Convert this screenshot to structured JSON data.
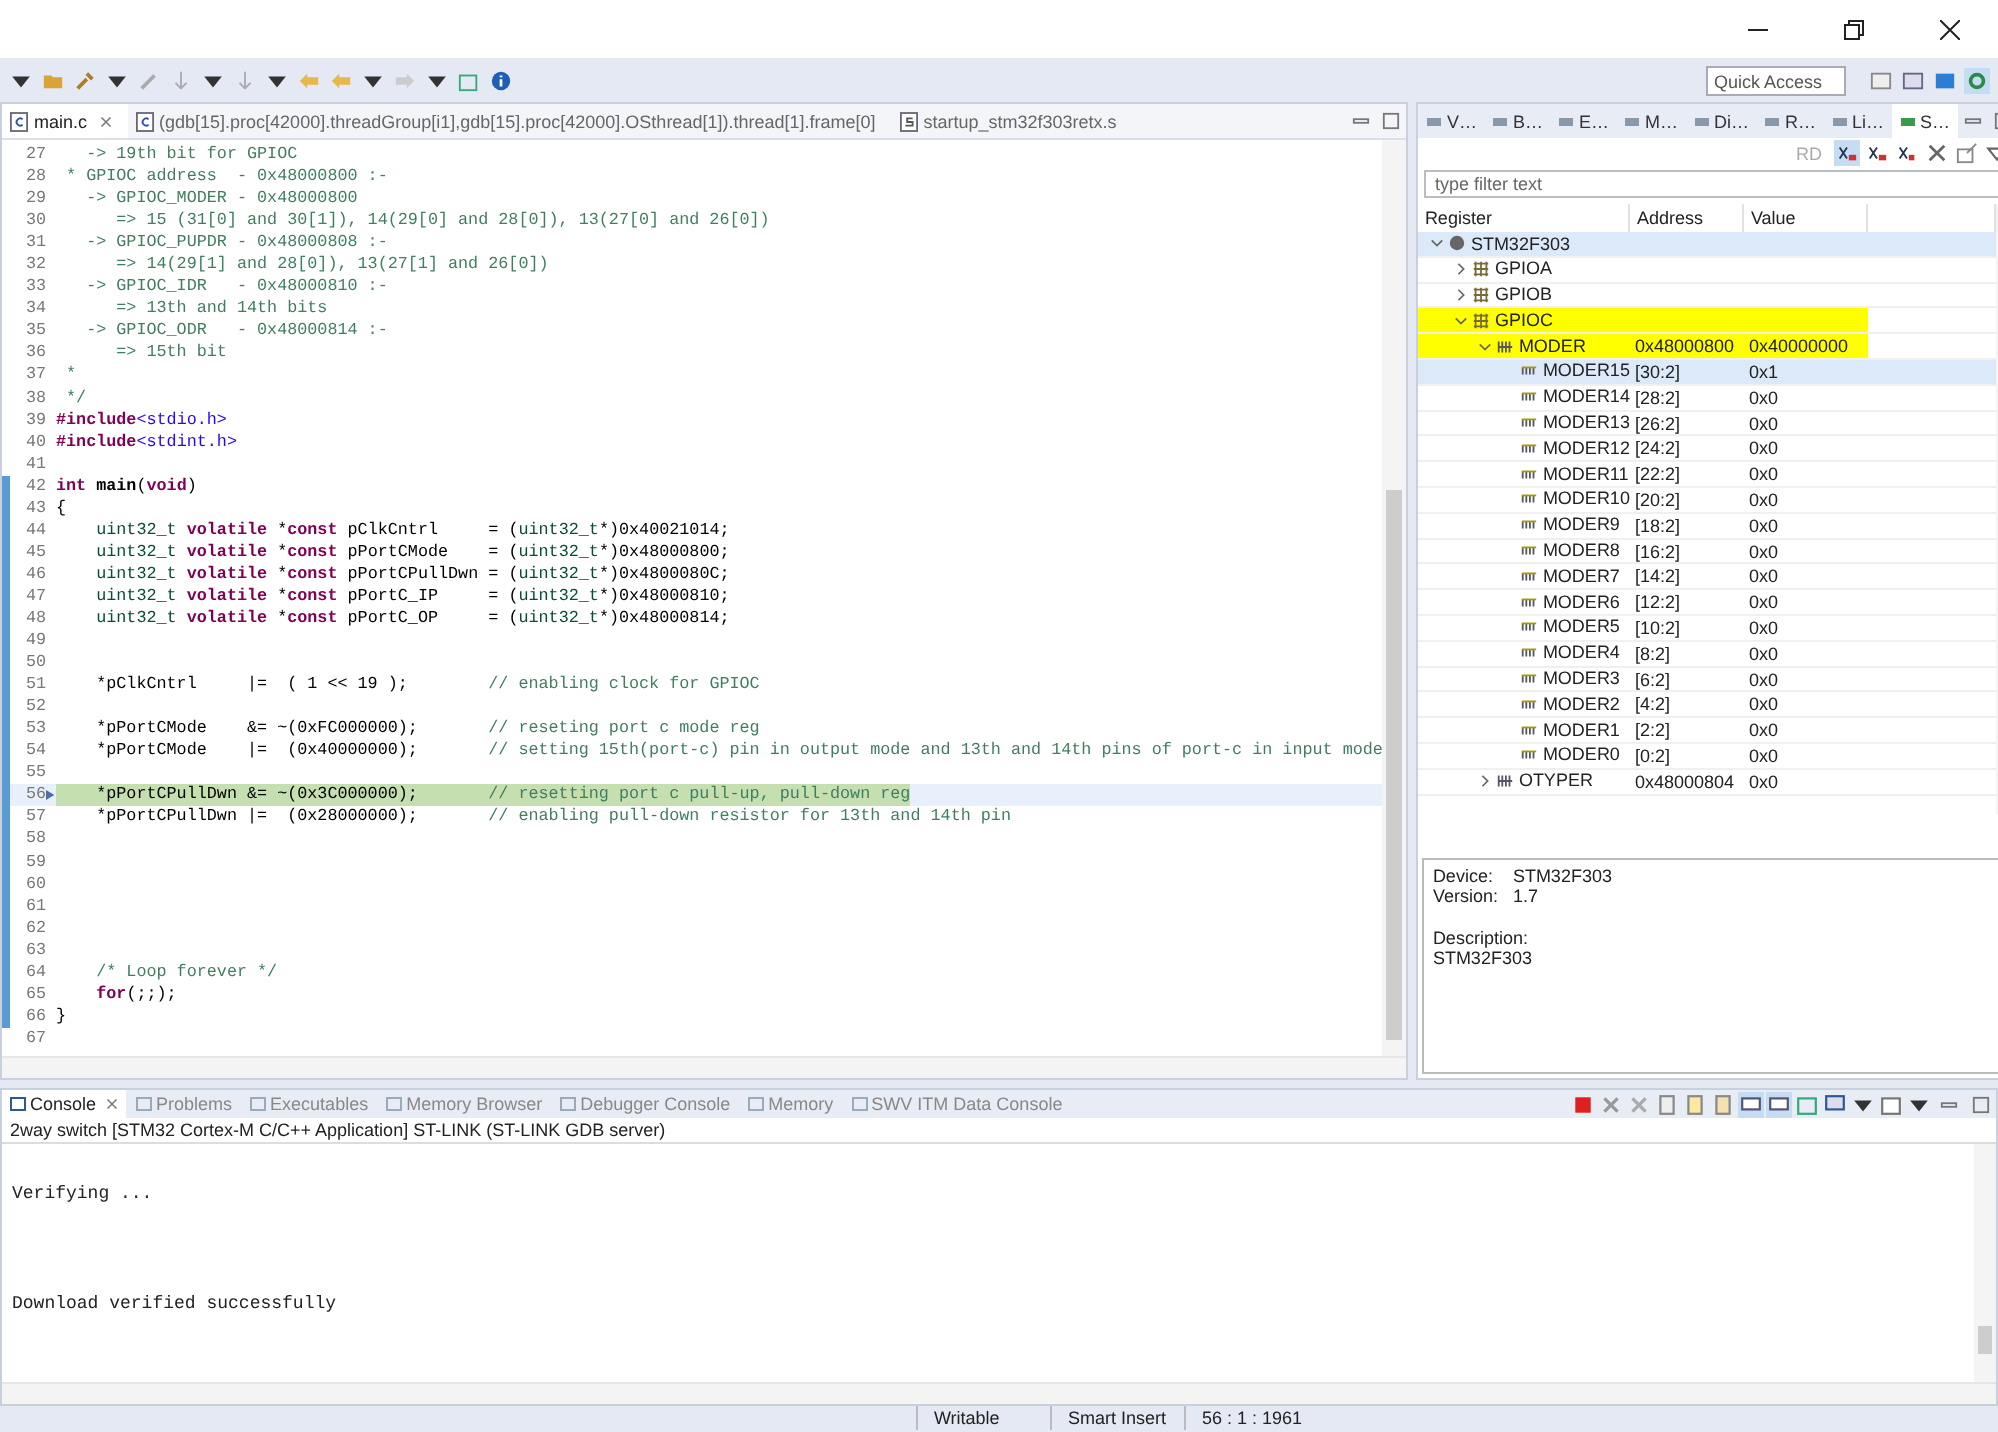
{
  "toolbar": {
    "quick_access": {
      "placeholder": "Quick Access"
    }
  },
  "editor": {
    "tabs": [
      {
        "label": "main.c",
        "kind": "c",
        "selected": true
      },
      {
        "label": "(gdb[15].proc[42000].threadGroup[i1],gdb[15].proc[42000].OSthread[1]).thread[1].frame[0]",
        "kind": "c",
        "selected": false
      },
      {
        "label": "startup_stm32f303retx.s",
        "kind": "s",
        "selected": false
      }
    ],
    "lines": [
      {
        "number": "27",
        "current": false,
        "scope": false,
        "segments": [
          {
            "kind": "comment",
            "text": "   -> 19th bit for GPIOC"
          }
        ]
      },
      {
        "number": "28",
        "current": false,
        "scope": false,
        "segments": [
          {
            "kind": "comment",
            "text": " * GPIOC address  - 0x48000800 :-"
          }
        ]
      },
      {
        "number": "29",
        "current": false,
        "scope": false,
        "segments": [
          {
            "kind": "comment",
            "text": "   -> GPIOC_MODER - 0x48000800"
          }
        ]
      },
      {
        "number": "30",
        "current": false,
        "scope": false,
        "segments": [
          {
            "kind": "comment",
            "text": "      => 15 (31[0] and 30[1]), 14(29[0] and 28[0]), 13(27[0] and 26[0])"
          }
        ]
      },
      {
        "number": "31",
        "current": false,
        "scope": false,
        "segments": [
          {
            "kind": "comment",
            "text": "   -> GPIOC_PUPDR - 0x48000808 :-"
          }
        ]
      },
      {
        "number": "32",
        "current": false,
        "scope": false,
        "segments": [
          {
            "kind": "comment",
            "text": "      => 14(29[1] and 28[0]), 13(27[1] and 26[0])"
          }
        ]
      },
      {
        "number": "33",
        "current": false,
        "scope": false,
        "segments": [
          {
            "kind": "comment",
            "text": "   -> GPIOC_IDR   - 0x48000810 :-"
          }
        ]
      },
      {
        "number": "34",
        "current": false,
        "scope": false,
        "segments": [
          {
            "kind": "comment",
            "text": "      => 13th and 14th bits"
          }
        ]
      },
      {
        "number": "35",
        "current": false,
        "scope": false,
        "segments": [
          {
            "kind": "comment",
            "text": "   -> GPIOC_ODR   - 0x48000814 :-"
          }
        ]
      },
      {
        "number": "36",
        "current": false,
        "scope": false,
        "segments": [
          {
            "kind": "comment",
            "text": "      => 15th bit"
          }
        ]
      },
      {
        "number": "37",
        "current": false,
        "scope": false,
        "segments": [
          {
            "kind": "comment",
            "text": " *"
          }
        ]
      },
      {
        "number": "38",
        "current": false,
        "scope": false,
        "segments": [
          {
            "kind": "comment",
            "text": " */"
          }
        ]
      },
      {
        "number": "39",
        "current": false,
        "scope": false,
        "segments": [
          {
            "kind": "directive",
            "text": "#include"
          },
          {
            "kind": "header",
            "text": "<stdio.h>"
          }
        ]
      },
      {
        "number": "40",
        "current": false,
        "scope": false,
        "segments": [
          {
            "kind": "directive",
            "text": "#include"
          },
          {
            "kind": "header",
            "text": "<stdint.h>"
          }
        ]
      },
      {
        "number": "41",
        "current": false,
        "scope": false
      },
      {
        "number": "42",
        "current": false,
        "scope": true,
        "segments": [
          {
            "kind": "keyword",
            "text": "int"
          },
          {
            "kind": "function",
            "text": " main"
          },
          {
            "kind": "plain",
            "text": "("
          },
          {
            "kind": "keyword",
            "text": "void"
          },
          {
            "kind": "plain",
            "text": ")"
          }
        ]
      },
      {
        "number": "43",
        "current": false,
        "scope": true,
        "segments": [
          {
            "kind": "plain",
            "text": "{"
          }
        ]
      },
      {
        "number": "44",
        "current": false,
        "scope": true,
        "segments": [
          {
            "kind": "type",
            "text": "    uint32_t"
          },
          {
            "kind": "keyword",
            "text": " volatile"
          },
          {
            "kind": "plain",
            "text": " *"
          },
          {
            "kind": "keyword",
            "text": "const"
          },
          {
            "kind": "plain",
            "text": " pClkCntrl     = ("
          },
          {
            "kind": "type",
            "text": "uint32_t"
          },
          {
            "kind": "plain",
            "text": "*)0x40021014;"
          }
        ]
      },
      {
        "number": "45",
        "current": false,
        "scope": true,
        "segments": [
          {
            "kind": "type",
            "text": "    uint32_t"
          },
          {
            "kind": "keyword",
            "text": " volatile"
          },
          {
            "kind": "plain",
            "text": " *"
          },
          {
            "kind": "keyword",
            "text": "const"
          },
          {
            "kind": "plain",
            "text": " pPortCMode    = ("
          },
          {
            "kind": "type",
            "text": "uint32_t"
          },
          {
            "kind": "plain",
            "text": "*)0x48000800;"
          }
        ]
      },
      {
        "number": "46",
        "current": false,
        "scope": true,
        "segments": [
          {
            "kind": "type",
            "text": "    uint32_t"
          },
          {
            "kind": "keyword",
            "text": " volatile"
          },
          {
            "kind": "plain",
            "text": " *"
          },
          {
            "kind": "keyword",
            "text": "const"
          },
          {
            "kind": "plain",
            "text": " pPortCPullDwn = ("
          },
          {
            "kind": "type",
            "text": "uint32_t"
          },
          {
            "kind": "plain",
            "text": "*)0x4800080C;"
          }
        ]
      },
      {
        "number": "47",
        "current": false,
        "scope": true,
        "segments": [
          {
            "kind": "type",
            "text": "    uint32_t"
          },
          {
            "kind": "keyword",
            "text": " volatile"
          },
          {
            "kind": "plain",
            "text": " *"
          },
          {
            "kind": "keyword",
            "text": "const"
          },
          {
            "kind": "plain",
            "text": " pPortC_IP     = ("
          },
          {
            "kind": "type",
            "text": "uint32_t"
          },
          {
            "kind": "plain",
            "text": "*)0x48000810;"
          }
        ]
      },
      {
        "number": "48",
        "current": false,
        "scope": true,
        "segments": [
          {
            "kind": "type",
            "text": "    uint32_t"
          },
          {
            "kind": "keyword",
            "text": " volatile"
          },
          {
            "kind": "plain",
            "text": " *"
          },
          {
            "kind": "keyword",
            "text": "const"
          },
          {
            "kind": "plain",
            "text": " pPortC_OP     = ("
          },
          {
            "kind": "type",
            "text": "uint32_t"
          },
          {
            "kind": "plain",
            "text": "*)0x48000814;"
          }
        ]
      },
      {
        "number": "49",
        "current": false,
        "scope": true
      },
      {
        "number": "50",
        "current": false,
        "scope": true
      },
      {
        "number": "51",
        "current": false,
        "scope": true,
        "segments": [
          {
            "kind": "plain",
            "text": "    *pClkCntrl     |=  ( 1 << 19 );        "
          },
          {
            "kind": "comment",
            "text": "// enabling clock for GPIOC"
          }
        ]
      },
      {
        "number": "52",
        "current": false,
        "scope": true
      },
      {
        "number": "53",
        "current": false,
        "scope": true,
        "segments": [
          {
            "kind": "plain",
            "text": "    *pPortCMode    &= ~(0xFC000000);       "
          },
          {
            "kind": "comment",
            "text": "// reseting port c mode reg"
          }
        ]
      },
      {
        "number": "54",
        "current": false,
        "scope": true,
        "segments": [
          {
            "kind": "plain",
            "text": "    *pPortCMode    |=  (0x40000000);       "
          },
          {
            "kind": "comment",
            "text": "// setting 15th(port-c) pin in output mode and 13th and 14th pins of port-c in input mode"
          }
        ]
      },
      {
        "number": "55",
        "current": false,
        "scope": true
      },
      {
        "number": "56",
        "current": true,
        "marked": true,
        "scope": true,
        "segments": [
          {
            "kind": "plain",
            "text": "    *pPortCPullDwn &= ~(0x3C000000);       "
          },
          {
            "kind": "comment",
            "text": "// resetting port c pull-up, pull-down reg"
          }
        ]
      },
      {
        "number": "57",
        "current": false,
        "scope": true,
        "segments": [
          {
            "kind": "plain",
            "text": "    *pPortCPullDwn |=  (0x28000000);       "
          },
          {
            "kind": "comment",
            "text": "// enabling pull-down resistor for 13th and 14th pin"
          }
        ]
      },
      {
        "number": "58",
        "current": false,
        "scope": true
      },
      {
        "number": "59",
        "current": false,
        "scope": true
      },
      {
        "number": "60",
        "current": false,
        "scope": true
      },
      {
        "number": "61",
        "current": false,
        "scope": true
      },
      {
        "number": "62",
        "current": false,
        "scope": true
      },
      {
        "number": "63",
        "current": false,
        "scope": true
      },
      {
        "number": "64",
        "current": false,
        "scope": true,
        "segments": [
          {
            "kind": "comment",
            "text": "    /* Loop forever */"
          }
        ]
      },
      {
        "number": "65",
        "current": false,
        "scope": true,
        "segments": [
          {
            "kind": "keyword",
            "text": "    for"
          },
          {
            "kind": "plain",
            "text": "(;;);"
          }
        ]
      },
      {
        "number": "66",
        "current": false,
        "scope": true,
        "segments": [
          {
            "kind": "plain",
            "text": "}"
          }
        ]
      },
      {
        "number": "67",
        "current": false,
        "scope": false
      }
    ]
  },
  "registers": {
    "tabs": [
      {
        "label": "V…",
        "selected": false
      },
      {
        "label": "B…",
        "selected": false
      },
      {
        "label": "E…",
        "selected": false
      },
      {
        "label": "M…",
        "selected": false
      },
      {
        "label": "Di…",
        "selected": false
      },
      {
        "label": "R…",
        "selected": false
      },
      {
        "label": "Li…",
        "selected": false
      },
      {
        "label": "S…",
        "selected": true
      }
    ],
    "toolbar_text": "RD",
    "filter": {
      "placeholder": "type filter text"
    },
    "columns": [
      "Register",
      "Address",
      "Value"
    ],
    "rows": [
      {
        "name": "STM32F303",
        "kind": "device",
        "expanded": true,
        "selected": true,
        "highlighted": false,
        "children": [
          {
            "name": "GPIOA",
            "kind": "peripheral",
            "expanded": false,
            "selected": false,
            "highlighted": false
          },
          {
            "name": "GPIOB",
            "kind": "peripheral",
            "expanded": false,
            "selected": false,
            "highlighted": false
          },
          {
            "name": "GPIOC",
            "kind": "peripheral",
            "expanded": true,
            "selected": false,
            "highlighted": true,
            "children": [
              {
                "name": "MODER",
                "kind": "register",
                "address": "0x48000800",
                "value": "0x40000000",
                "expanded": true,
                "selected": false,
                "highlighted": true,
                "children": [
                  {
                    "name": "MODER15",
                    "kind": "field",
                    "address": "[30:2]",
                    "value": "0x1",
                    "selected": true,
                    "highlighted": false
                  },
                  {
                    "name": "MODER14",
                    "kind": "field",
                    "address": "[28:2]",
                    "value": "0x0",
                    "selected": false,
                    "highlighted": false
                  },
                  {
                    "name": "MODER13",
                    "kind": "field",
                    "address": "[26:2]",
                    "value": "0x0",
                    "selected": false,
                    "highlighted": false
                  },
                  {
                    "name": "MODER12",
                    "kind": "field",
                    "address": "[24:2]",
                    "value": "0x0",
                    "selected": false,
                    "highlighted": false
                  },
                  {
                    "name": "MODER11",
                    "kind": "field",
                    "address": "[22:2]",
                    "value": "0x0",
                    "selected": false,
                    "highlighted": false
                  },
                  {
                    "name": "MODER10",
                    "kind": "field",
                    "address": "[20:2]",
                    "value": "0x0",
                    "selected": false,
                    "highlighted": false
                  },
                  {
                    "name": "MODER9",
                    "kind": "field",
                    "address": "[18:2]",
                    "value": "0x0",
                    "selected": false,
                    "highlighted": false
                  },
                  {
                    "name": "MODER8",
                    "kind": "field",
                    "address": "[16:2]",
                    "value": "0x0",
                    "selected": false,
                    "highlighted": false
                  },
                  {
                    "name": "MODER7",
                    "kind": "field",
                    "address": "[14:2]",
                    "value": "0x0",
                    "selected": false,
                    "highlighted": false
                  },
                  {
                    "name": "MODER6",
                    "kind": "field",
                    "address": "[12:2]",
                    "value": "0x0",
                    "selected": false,
                    "highlighted": false
                  },
                  {
                    "name": "MODER5",
                    "kind": "field",
                    "address": "[10:2]",
                    "value": "0x0",
                    "selected": false,
                    "highlighted": false
                  },
                  {
                    "name": "MODER4",
                    "kind": "field",
                    "address": "[8:2]",
                    "value": "0x0",
                    "selected": false,
                    "highlighted": false
                  },
                  {
                    "name": "MODER3",
                    "kind": "field",
                    "address": "[6:2]",
                    "value": "0x0",
                    "selected": false,
                    "highlighted": false
                  },
                  {
                    "name": "MODER2",
                    "kind": "field",
                    "address": "[4:2]",
                    "value": "0x0",
                    "selected": false,
                    "highlighted": false
                  },
                  {
                    "name": "MODER1",
                    "kind": "field",
                    "address": "[2:2]",
                    "value": "0x0",
                    "selected": false,
                    "highlighted": false
                  },
                  {
                    "name": "MODER0",
                    "kind": "field",
                    "address": "[0:2]",
                    "value": "0x0",
                    "selected": false,
                    "highlighted": false
                  }
                ]
              },
              {
                "name": "OTYPER",
                "kind": "register",
                "address": "0x48000804",
                "value": "0x0",
                "expanded": false,
                "selected": false,
                "highlighted": false
              }
            ]
          }
        ]
      }
    ],
    "details": [
      {
        "label": "Device:",
        "value": "STM32F303"
      },
      {
        "label": "Version:",
        "value": "1.7"
      }
    ],
    "description": {
      "label": "Description:",
      "text": "STM32F303"
    }
  },
  "console": {
    "tabs": [
      {
        "label": "Console",
        "selected": true
      },
      {
        "label": "Problems",
        "selected": false
      },
      {
        "label": "Executables",
        "selected": false
      },
      {
        "label": "Memory Browser",
        "selected": false
      },
      {
        "label": "Debugger Console",
        "selected": false
      },
      {
        "label": "Memory",
        "selected": false
      },
      {
        "label": "SWV ITM Data Console",
        "selected": false
      }
    ],
    "header": "2way switch [STM32 Cortex-M C/C++ Application] ST-LINK (ST-LINK GDB server)",
    "lines": [
      "Verifying ...",
      "Download verified successfully"
    ]
  },
  "status_bar": [
    "Writable",
    "Smart Insert",
    "56 : 1 : 1961"
  ]
}
